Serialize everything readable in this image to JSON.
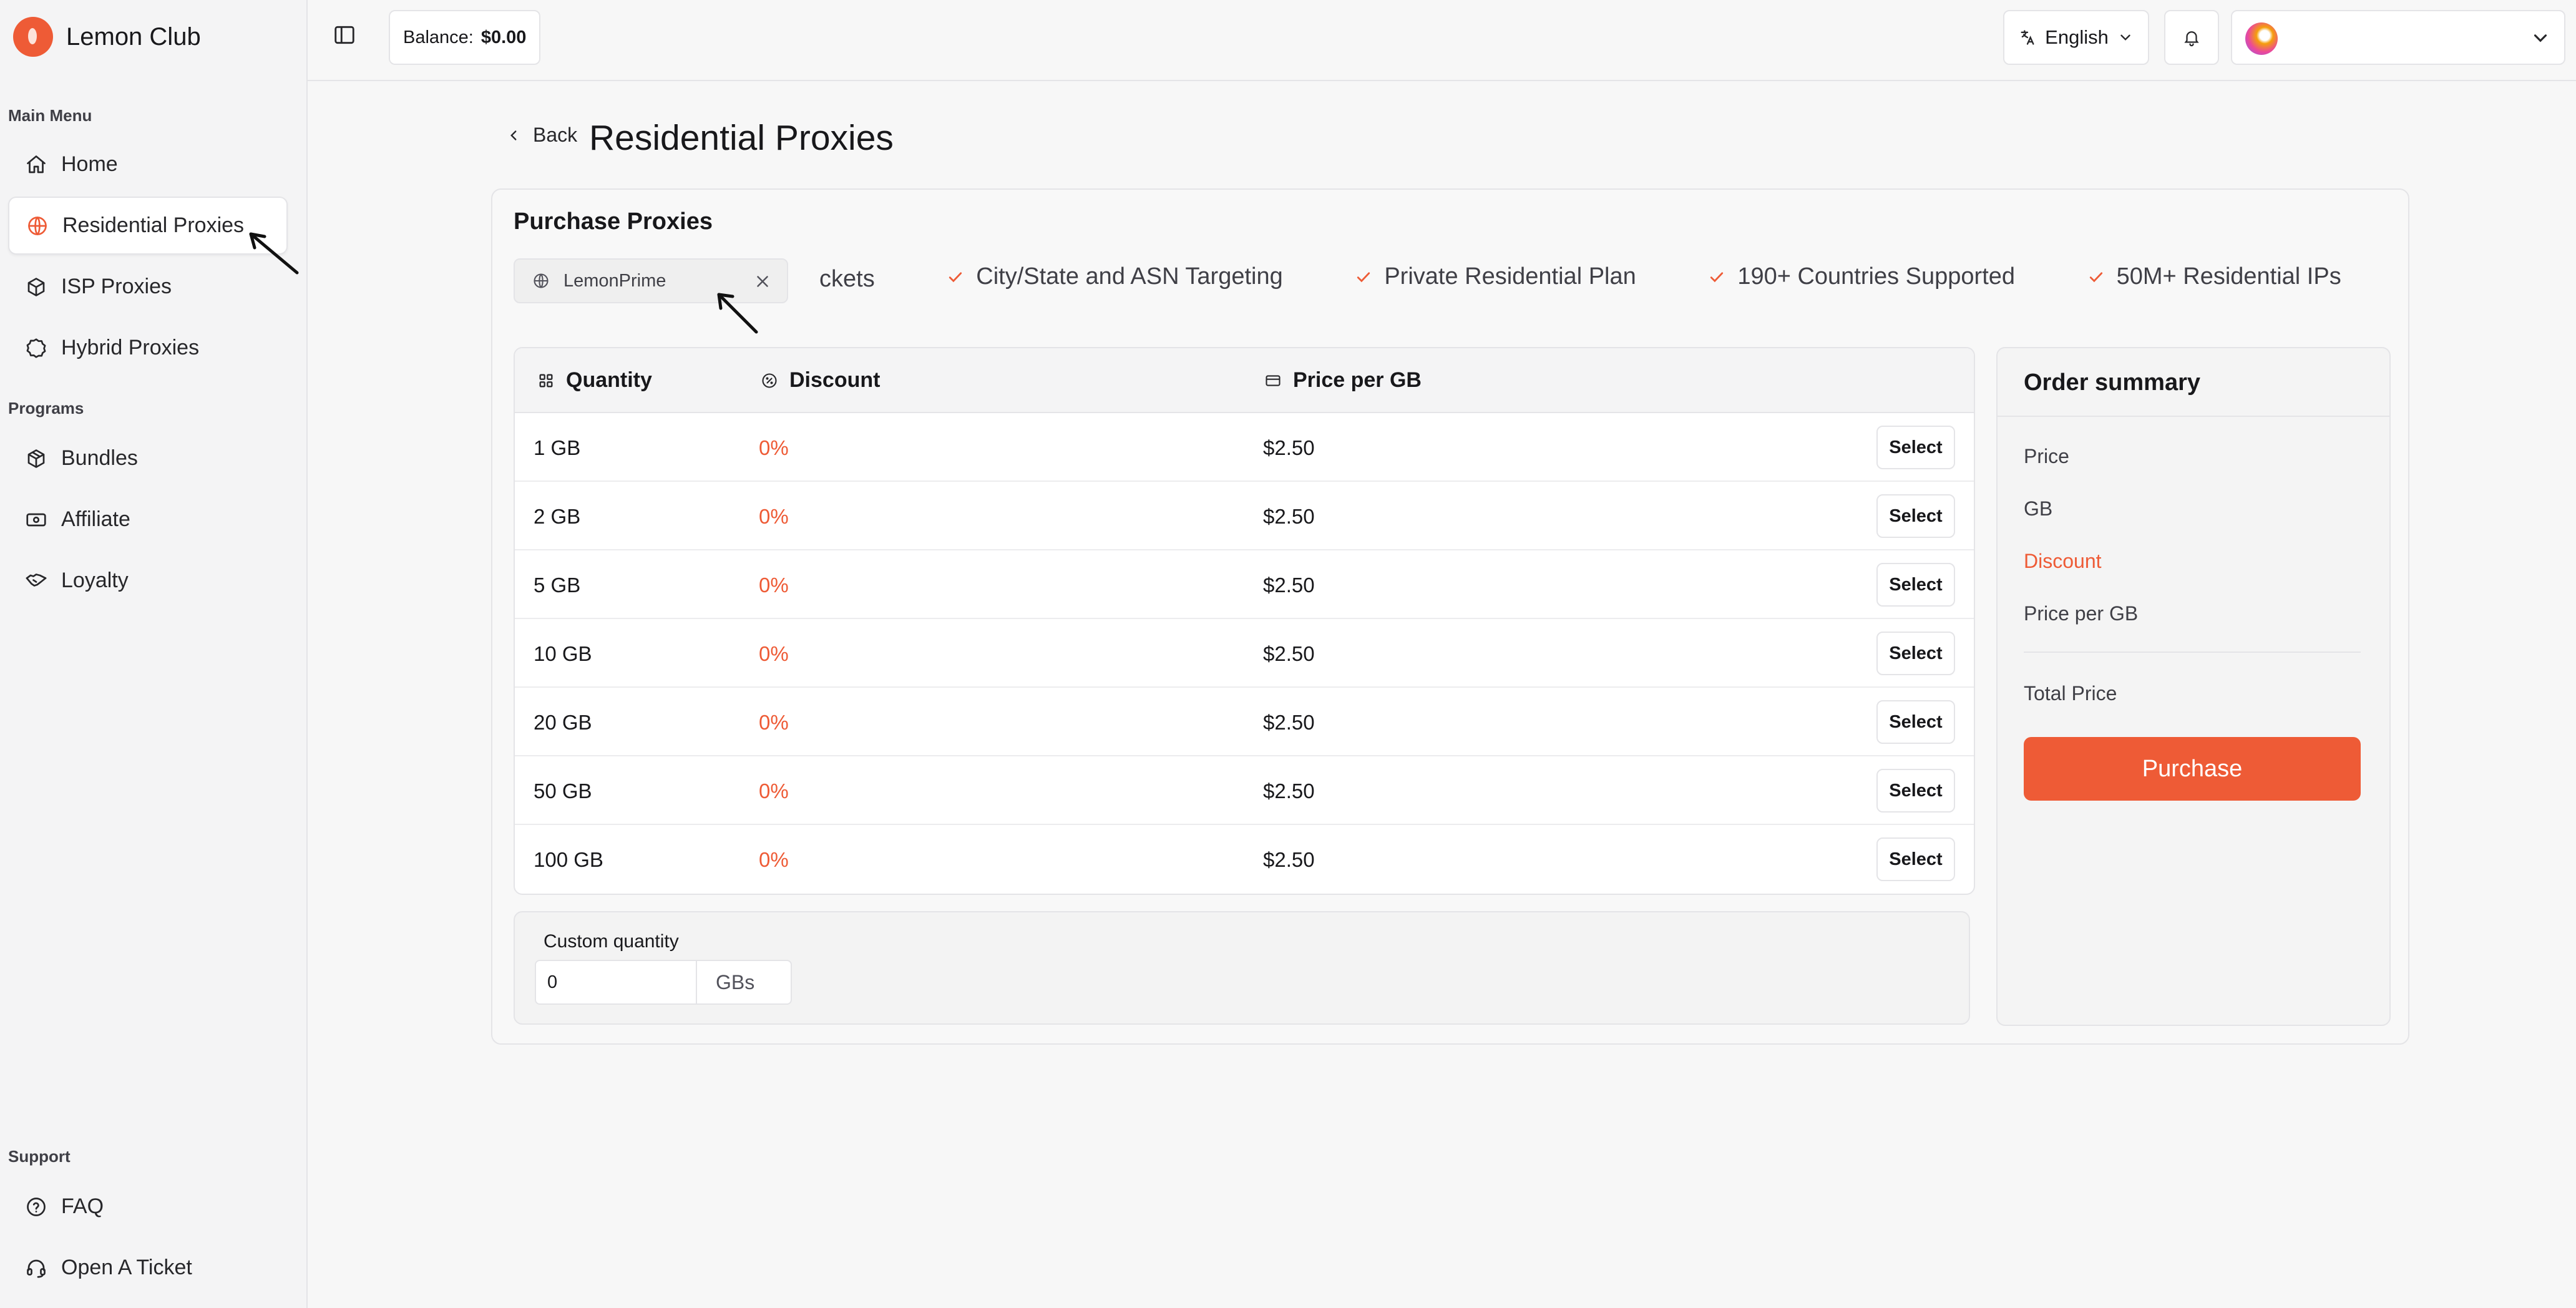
{
  "app": {
    "name": "Lemon Club"
  },
  "sidebar": {
    "sections": [
      {
        "label": "Main Menu"
      },
      {
        "label": "Programs"
      },
      {
        "label": "Support"
      }
    ],
    "items": [
      {
        "label": "Home",
        "icon": "home-icon"
      },
      {
        "label": "Residential Proxies",
        "icon": "globe-icon",
        "active": true
      },
      {
        "label": "ISP Proxies",
        "icon": "box-icon"
      },
      {
        "label": "Hybrid Proxies",
        "icon": "badge-icon"
      },
      {
        "label": "Bundles",
        "icon": "package-icon"
      },
      {
        "label": "Affiliate",
        "icon": "banknote-icon"
      },
      {
        "label": "Loyalty",
        "icon": "handshake-icon"
      },
      {
        "label": "FAQ",
        "icon": "help-circle-icon"
      },
      {
        "label": "Open A Ticket",
        "icon": "headset-icon"
      }
    ]
  },
  "topbar": {
    "balance_label": "Balance:",
    "balance_value": "$0.00",
    "language": "English"
  },
  "page": {
    "back_label": "Back",
    "title": "Residential Proxies"
  },
  "purchase": {
    "title": "Purchase Proxies",
    "plan_chip": "LemonPrime",
    "features": [
      "ckets",
      "City/State and ASN Targeting",
      "Private Residential Plan",
      "190+ Countries Supported",
      "50M+ Residential IPs"
    ],
    "columns": {
      "quantity": "Quantity",
      "discount": "Discount",
      "price_per_gb": "Price per GB"
    },
    "select_label": "Select",
    "rows": [
      {
        "quantity": "1 GB",
        "discount": "0%",
        "price": "$2.50"
      },
      {
        "quantity": "2 GB",
        "discount": "0%",
        "price": "$2.50"
      },
      {
        "quantity": "5 GB",
        "discount": "0%",
        "price": "$2.50"
      },
      {
        "quantity": "10 GB",
        "discount": "0%",
        "price": "$2.50"
      },
      {
        "quantity": "20 GB",
        "discount": "0%",
        "price": "$2.50"
      },
      {
        "quantity": "50 GB",
        "discount": "0%",
        "price": "$2.50"
      },
      {
        "quantity": "100 GB",
        "discount": "0%",
        "price": "$2.50"
      }
    ],
    "custom": {
      "label": "Custom quantity",
      "value": "0",
      "unit": "GBs"
    }
  },
  "summary": {
    "title": "Order summary",
    "price": "Price",
    "gb": "GB",
    "discount": "Discount",
    "price_per_gb": "Price per GB",
    "total": "Total Price",
    "button": "Purchase"
  },
  "colors": {
    "accent": "#ee5b36",
    "border": "#e4e4e7"
  }
}
